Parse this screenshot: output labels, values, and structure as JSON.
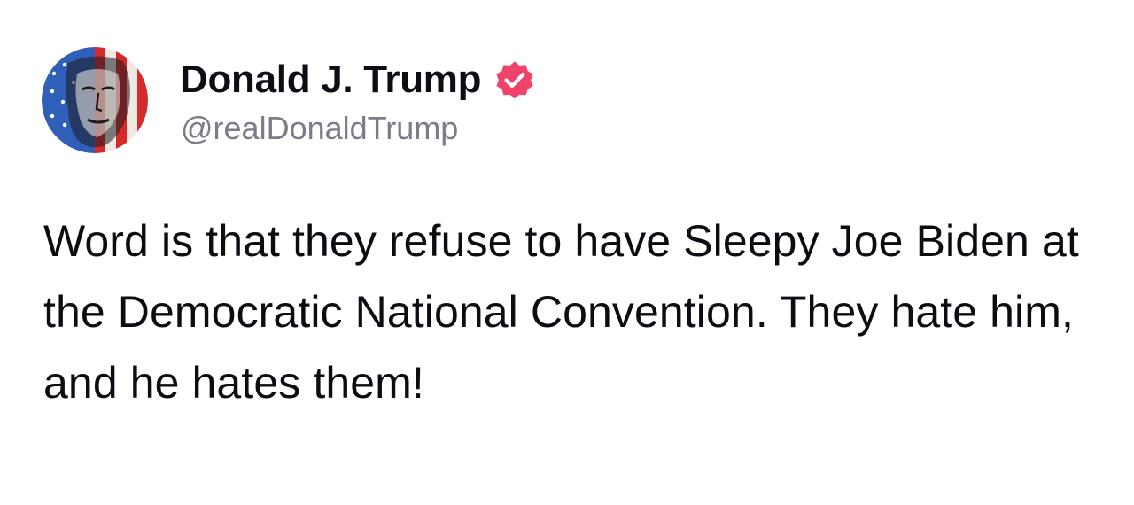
{
  "post": {
    "author": {
      "display_name": "Donald J. Trump",
      "handle": "@realDonaldTrump",
      "verified": true,
      "verified_badge_color": "#f0426a",
      "avatar_icon": "profile-avatar-flag-portrait"
    },
    "text": "Word is that they refuse to have Sleepy Joe Biden at the Democratic National Convention. They hate him, and he hates them!"
  }
}
